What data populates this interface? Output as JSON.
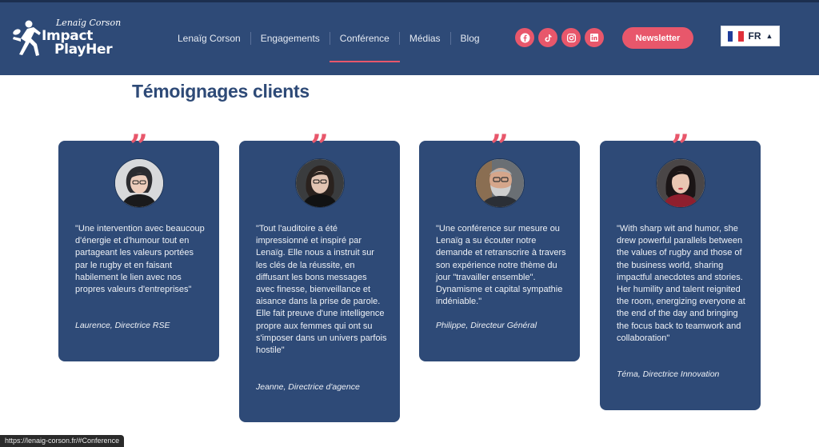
{
  "brand": {
    "script": "Lenaïg Corson",
    "line1": "Impact",
    "line2": "PlayHer"
  },
  "nav": {
    "items": [
      "Lenaïg Corson",
      "Engagements",
      "Conférence",
      "Médias",
      "Blog"
    ],
    "active": "Conférence"
  },
  "socials": [
    "facebook-icon",
    "tiktok-icon",
    "instagram-icon",
    "linkedin-icon"
  ],
  "newsletter_label": "Newsletter",
  "language": {
    "code": "FR"
  },
  "colors": {
    "navy": "#2e4a77",
    "accent": "#e8576b",
    "white": "#ffffff"
  },
  "section_title": "Témoignages clients",
  "testimonials": [
    {
      "text": "\"Une intervention avec beaucoup d'énergie et d'humour tout en partageant les valeurs portées par le rugby et en faisant habilement le lien avec nos propres valeurs d'entreprises\"",
      "author": "Laurence, Directrice RSE"
    },
    {
      "text": "\"Tout l'auditoire a été impressionné et inspiré par Lenaïg. Elle nous a instruit sur les clés de la réussite, en diffusant les bons messages avec finesse, bienveillance et aisance dans la prise de parole. Elle fait preuve d'une intelligence propre aux femmes qui ont su s'imposer dans un univers parfois hostile\"",
      "author": "Jeanne, Directrice d'agence"
    },
    {
      "text": "\"Une conférence sur mesure ou Lenaïg a su écouter notre demande et retranscrire à travers son expérience notre thème du jour \"travailler ensemble\". Dynamisme et capital sympathie indéniable.\"",
      "author": "Philippe, Directeur Général"
    },
    {
      "text": "\"With sharp wit and humor, she drew powerful parallels between the values of rugby and those of the business world, sharing impactful anecdotes and stories. Her humility and talent reignited the room, energizing everyone at the end of the day and bringing the focus back to teamwork and collaboration\"",
      "author": "Téma, Directrice Innovation"
    }
  ],
  "status_url": "https://lenaig-corson.fr/#Conference"
}
